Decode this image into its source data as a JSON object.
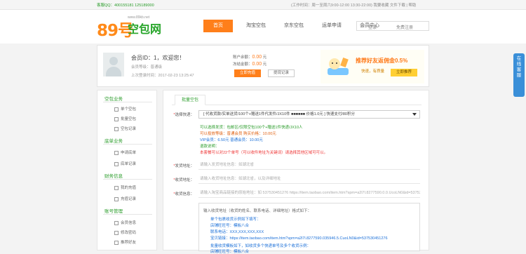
{
  "topbar": {
    "left_text": "客服QQ：400155181  125189000",
    "right_text": "(工作时间：周一至周六9:00-12:00 13:30-22:00)    我要收藏    文件下载 | 帮助"
  },
  "logo": {
    "number": "89号",
    "name": "空包网",
    "url_hint": "www.89kb.net"
  },
  "nav": {
    "items": [
      "首页",
      "淘宝空包",
      "京东空包",
      "运单申请",
      "会员中心"
    ],
    "login": "登录",
    "register": "免费注册"
  },
  "account": {
    "greeting": "会员ID：1，欢迎您！",
    "level": "会员等级：普通级",
    "last_login": "上次登录时间：2017-02-23 13:25:47",
    "balance_label": "账户余额：",
    "balance_value": "0.00",
    "balance_unit": "元",
    "frozen_label": "冻结金额：",
    "frozen_value": "0.00",
    "frozen_unit": "元",
    "recharge_button": "立即充值",
    "withdraw_button": "提现记录"
  },
  "promo": {
    "title": "推荐好友返佣金0.5%",
    "subtitle": "快速，有质量",
    "button": "立即推荐"
  },
  "sidebar": {
    "sections": [
      {
        "title": "空包业务",
        "items": [
          "单个空包",
          "批量空包",
          "空包记录"
        ]
      },
      {
        "title": "底单业务",
        "items": [
          "申请底单",
          "底单记录"
        ]
      },
      {
        "title": "财务信息",
        "items": [
          "我的充值",
          "充值记录"
        ]
      },
      {
        "title": "账号管理",
        "items": [
          "会员信息",
          "修改密码",
          "推荐好友"
        ]
      }
    ]
  },
  "main": {
    "tab": "批量空包",
    "express_label": "选择快递：",
    "express_value": "[  代收货款/实单送货/100个+赠送1件代发件/JX10件 ■■■■■■ 价格1.0元  ] 快速支付/80积分",
    "info_lines": [
      "可以选择发货：包邮区/仅限空包100个+赠送1件快递/JX10人",
      "可以投放等级：普通会员  购买价格：10.00元",
      "VIP会员：6.50元  普通会员：10.00元",
      "退款说明：",
      "本套餐可以对22个单号（可以收件地址为关键词）请选择其他区域可可以。"
    ],
    "sender_label": "发货地址：",
    "sender_placeholder": "请输入发货地址信息：如湖北省",
    "receiver_label": "收货地址：",
    "receiver_placeholder": "请输入收货地址信息：如湖北省，以及详细地址",
    "address_label": "收货信息：",
    "address_placeholder": "请输入淘宝商品链接的原始地址：如 537530451276 https://item.taobao.com/item.htm?spm=a2l7l.8277590.0.0.UcoLN0&id=537530451276",
    "textarea_lines": [
      "输入收货地址（收货的姓名、联系电话、详细地址）格式如下：",
      "单个包裹收货示例如下填写：",
      "店铺旺旺号：模板八合",
      "联系电话：XXX,XXX,XXX,XXX",
      "宝贝链接：https://item.taobao.com/item.htm?spm=a2l7l.8277590.035946.5.CuoLN0&id=537530451276",
      "批量收货模板如下，如收货多个快递单号及多个收货示例：",
      "店铺旺旺号：模板八合"
    ]
  },
  "sidetab": {
    "label": "在线客服"
  }
}
